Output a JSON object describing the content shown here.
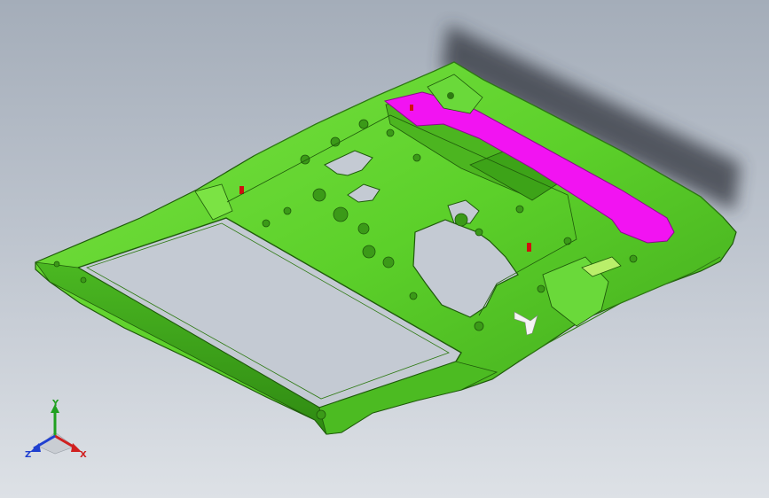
{
  "viewport": {
    "background_top": "#a4adb9",
    "background_bottom": "#dde1e6"
  },
  "model": {
    "part_color": "#5cd02a",
    "edge_color": "#1f5a0b",
    "highlight_color": "#f213f2",
    "marker_color": "#d01010",
    "shadow_color": "#3a3f47"
  },
  "triad": {
    "y_label": "Y",
    "x_label": "X",
    "z_label": "Z",
    "y_color": "#20a020",
    "x_color": "#d02020",
    "z_color": "#2040d0"
  }
}
